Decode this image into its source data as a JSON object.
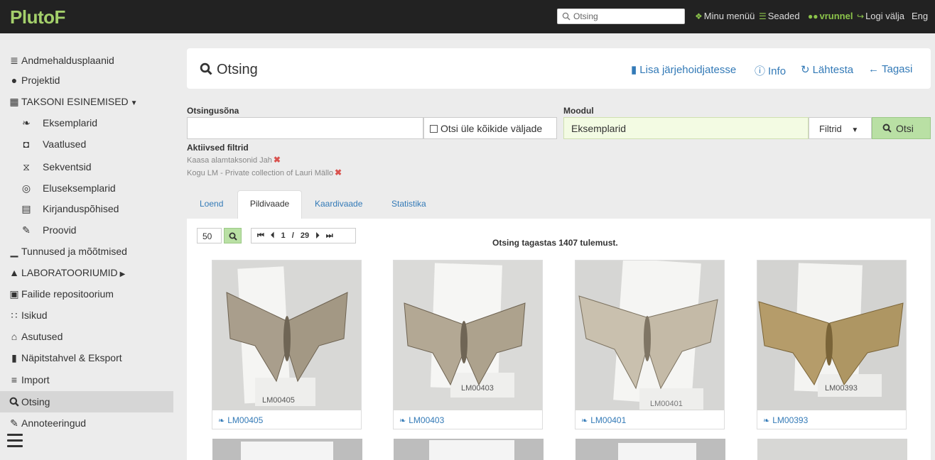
{
  "app": {
    "brand": "PlutoF"
  },
  "topnav": {
    "search_placeholder": "Otsing",
    "my_menu": "Minu menüü",
    "settings": "Seaded",
    "user": "vrunnel",
    "logout": "Logi välja",
    "language": "Eng"
  },
  "sidebar": {
    "items": [
      {
        "label": "Andmehaldusplaanid",
        "icon": "list-check-icon"
      },
      {
        "label": "Projektid",
        "icon": "globe-icon"
      },
      {
        "label": "TAKSONI ESINEMISED",
        "icon": "grid-icon"
      },
      {
        "label": "Eksemplarid",
        "icon": "leaf-icon"
      },
      {
        "label": "Vaatlused",
        "icon": "binoculars-icon"
      },
      {
        "label": "Sekventsid",
        "icon": "dna-icon"
      },
      {
        "label": "Eluseksemplarid",
        "icon": "petri-dish-icon"
      },
      {
        "label": "Kirjanduspõhised",
        "icon": "newspaper-icon"
      },
      {
        "label": "Proovid",
        "icon": "eyedropper-icon"
      },
      {
        "label": "Tunnused ja mõõtmised",
        "icon": "ruler-icon"
      },
      {
        "label": "LABORATOORIUMID",
        "icon": "flask-icon"
      },
      {
        "label": "Failide repositoorium",
        "icon": "floppy-icon"
      },
      {
        "label": "Isikud",
        "icon": "users-icon"
      },
      {
        "label": "Asutused",
        "icon": "institution-icon"
      },
      {
        "label": "Näpitstahvel & Eksport",
        "icon": "clipboard-icon"
      },
      {
        "label": "Import",
        "icon": "database-icon"
      },
      {
        "label": "Otsing",
        "icon": "search-icon"
      },
      {
        "label": "Annoteeringud",
        "icon": "marker-icon"
      }
    ]
  },
  "header": {
    "title": "Otsing",
    "bookmark": "Lisa järjehoidjatesse",
    "info": "Info",
    "reset": "Lähtesta",
    "back": "Tagasi"
  },
  "form": {
    "keyword_label": "Otsingusõna",
    "keyword_value": "",
    "search_all_label": "Otsi üle kõikide väljade",
    "module_label": "Moodul",
    "module_value": "Eksemplarid",
    "filters_label": "Filtrid",
    "search_button": "Otsi",
    "active_filters_label": "Aktiivsed filtrid",
    "active_filters": [
      "Kaasa alamtaksonid Jah",
      "Kogu LM - Private collection of Lauri Mällo"
    ]
  },
  "tabs": [
    "Loend",
    "Pildivaade",
    "Kaardivaade",
    "Statistika"
  ],
  "results": {
    "page_size": "50",
    "current_page": "1",
    "separator": "/",
    "total_pages": "29",
    "summary": "Otsing tagastas 1407 tulemust.",
    "cards": [
      {
        "id": "LM00405",
        "tag": "LM00405"
      },
      {
        "id": "LM00403",
        "tag": "LM00403"
      },
      {
        "id": "LM00401",
        "tag": "LM00401"
      },
      {
        "id": "LM00393",
        "tag": "LM00393"
      }
    ]
  },
  "colors": {
    "topbar": "#222222",
    "brand": "#a4d06b",
    "link": "#337ab7",
    "primary_green": "#b9e0a4",
    "module_bg": "#f3fbe3"
  }
}
